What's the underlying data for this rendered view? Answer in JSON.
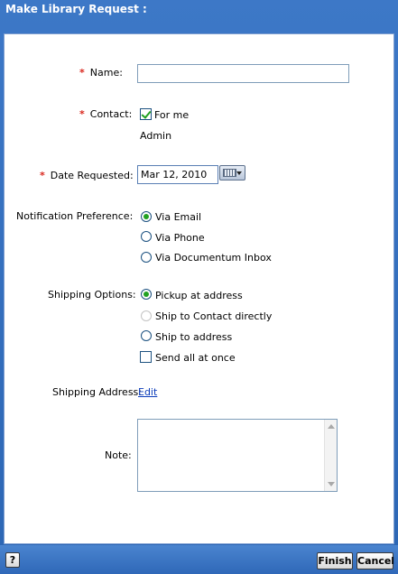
{
  "dialog": {
    "title": "Make Library Request :"
  },
  "form": {
    "name": {
      "label": "Name:",
      "value": ""
    },
    "contact": {
      "label": "Contact:",
      "for_me_label": "For me",
      "for_me_checked": true,
      "value": "Admin"
    },
    "date": {
      "label": "Date Requested:",
      "value": "Mar 12, 2010"
    },
    "notification": {
      "label": "Notification Preference:",
      "options": [
        "Via Email",
        "Via Phone",
        "Via Documentum Inbox"
      ],
      "selected": "Via Email"
    },
    "shipping": {
      "label": "Shipping Options:",
      "options": [
        "Pickup at address",
        "Ship to Contact directly",
        "Ship to address"
      ],
      "selected": "Pickup at address",
      "disabled": [
        "Ship to Contact directly"
      ],
      "send_all_label": "Send all at once",
      "send_all_checked": false
    },
    "address": {
      "label": "Shipping Address:",
      "edit_link": "Edit"
    },
    "note": {
      "label": "Note:",
      "value": ""
    }
  },
  "footer": {
    "help": "?",
    "finish": "Finish",
    "cancel": "Cancel"
  }
}
